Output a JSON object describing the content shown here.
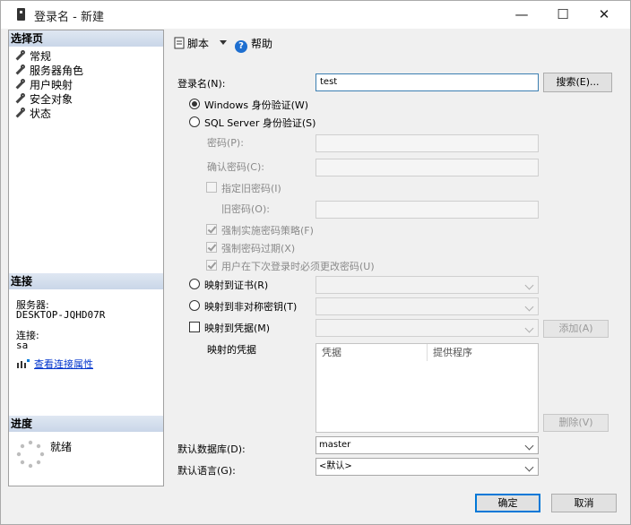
{
  "window": {
    "title": "登录名 - 新建",
    "minimize": "—",
    "maximize": "☐",
    "close": "✕"
  },
  "left": {
    "select_page_header": "选择页",
    "pages": [
      "常规",
      "服务器角色",
      "用户映射",
      "安全对象",
      "状态"
    ],
    "connection_header": "连接",
    "server_label": "服务器:",
    "server_value": "DESKTOP-JQHD07R",
    "connection_label": "连接:",
    "connection_value": "sa",
    "view_props_link": "查看连接属性",
    "progress_header": "进度",
    "progress_status": "就绪"
  },
  "toolbar": {
    "script_label": "脚本",
    "help_label": "帮助"
  },
  "form": {
    "login_name_label": "登录名(N):",
    "login_name_value": "test",
    "search_button": "搜索(E)...",
    "windows_auth": "Windows 身份验证(W)",
    "sql_auth": "SQL Server 身份验证(S)",
    "password_label": "密码(P):",
    "confirm_password_label": "确认密码(C):",
    "specify_old_password": "指定旧密码(I)",
    "old_password_label": "旧密码(O):",
    "enforce_policy": "强制实施密码策略(F)",
    "enforce_expiration": "强制密码过期(X)",
    "must_change": "用户在下次登录时必须更改密码(U)",
    "map_certificate": "映射到证书(R)",
    "map_asymmetric_key": "映射到非对称密钥(T)",
    "map_credential": "映射到凭据(M)",
    "add_button": "添加(A)",
    "mapped_credentials_label": "映射的凭据",
    "grid_col_credential": "凭据",
    "grid_col_provider": "提供程序",
    "remove_button": "删除(V)",
    "default_db_label": "默认数据库(D):",
    "default_db_value": "master",
    "default_lang_label": "默认语言(G):",
    "default_lang_value": "<默认>"
  },
  "footer": {
    "ok_button": "确定",
    "cancel_button": "取消"
  },
  "colors": {
    "accent": "#0078d7",
    "section_header": "#c9d6e8",
    "link": "#0033cc"
  }
}
